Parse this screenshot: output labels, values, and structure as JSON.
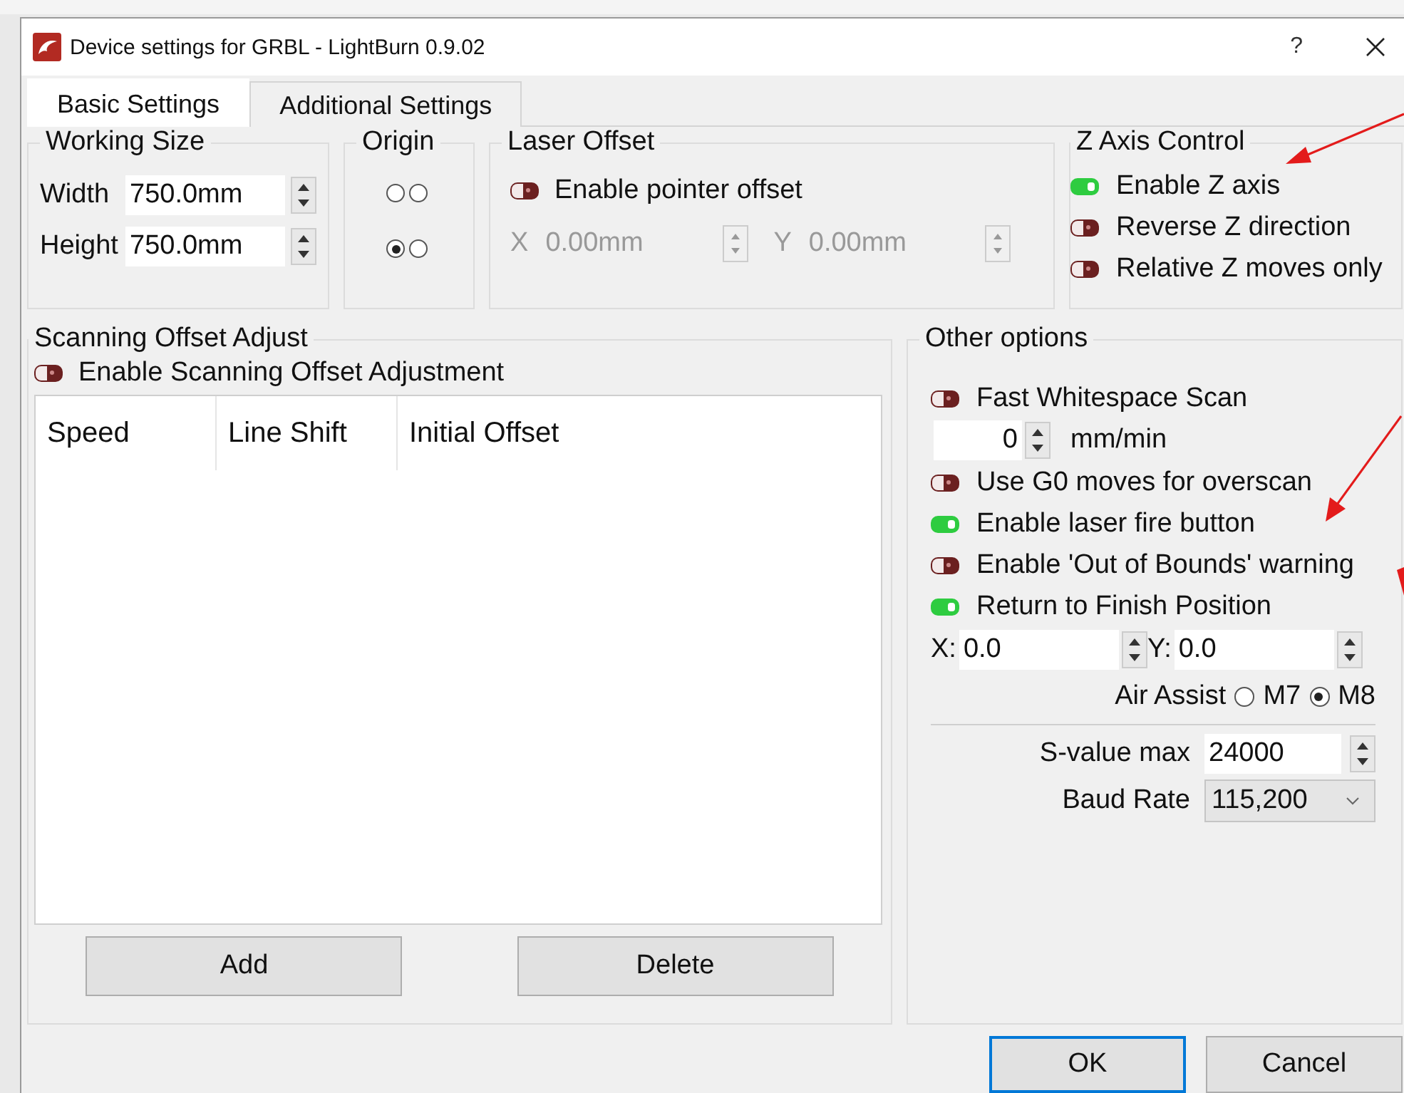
{
  "window": {
    "title": "Device settings for GRBL - LightBurn 0.9.02",
    "help": "?"
  },
  "tabs": [
    {
      "label": "Basic Settings",
      "selected": true
    },
    {
      "label": "Additional Settings",
      "selected": false
    }
  ],
  "working_size": {
    "title": "Working Size",
    "fields": [
      {
        "label": "Width",
        "value": "750.0mm"
      },
      {
        "label": "Height",
        "value": "750.0mm"
      }
    ]
  },
  "origin": {
    "title": "Origin",
    "radios": [
      {
        "selected": false
      },
      {
        "selected": false
      },
      {
        "selected": true
      },
      {
        "selected": false
      }
    ]
  },
  "laser_offset": {
    "title": "Laser Offset",
    "toggle": {
      "label": "Enable pointer offset",
      "on": false
    },
    "fields": [
      {
        "label": "X",
        "value": "0.00mm",
        "disabled": true
      },
      {
        "label": "Y",
        "value": "0.00mm",
        "disabled": true
      }
    ]
  },
  "z_axis": {
    "title": "Z Axis Control",
    "toggles": [
      {
        "label": "Enable Z axis",
        "on": true
      },
      {
        "label": "Reverse Z direction",
        "on": false
      },
      {
        "label": "Relative Z moves only",
        "on": false
      }
    ]
  },
  "scanning": {
    "title": "Scanning Offset Adjust",
    "toggle": {
      "label": "Enable Scanning Offset Adjustment",
      "on": false
    },
    "columns": [
      "Speed",
      "Line Shift",
      "Initial Offset"
    ],
    "buttons": [
      "Add",
      "Delete"
    ]
  },
  "other_options": {
    "title": "Other options",
    "rows": [
      {
        "kind": "toggle",
        "label": "Fast Whitespace Scan",
        "on": false
      },
      {
        "kind": "spin",
        "value": "0",
        "unit": "mm/min"
      },
      {
        "kind": "toggle",
        "label": "Use G0 moves for overscan",
        "on": false
      },
      {
        "kind": "toggle",
        "label": "Enable laser fire button",
        "on": true
      },
      {
        "kind": "toggle",
        "label": "Enable 'Out of Bounds' warning",
        "on": false
      },
      {
        "kind": "toggle",
        "label": "Return to Finish Position",
        "on": true
      },
      {
        "kind": "xy",
        "fields": [
          {
            "label": "X:",
            "value": "0.0"
          },
          {
            "label": "Y:",
            "value": "0.0"
          }
        ]
      },
      {
        "kind": "radio_group",
        "label": "Air Assist",
        "options": [
          {
            "label": "M7",
            "selected": false
          },
          {
            "label": "M8",
            "selected": true
          }
        ]
      }
    ],
    "settings": [
      {
        "kind": "spin",
        "label": "S-value max",
        "value": "24000"
      },
      {
        "kind": "dropdown",
        "label": "Baud Rate",
        "value": "115,200"
      }
    ]
  },
  "buttons": [
    "OK",
    "Cancel"
  ]
}
